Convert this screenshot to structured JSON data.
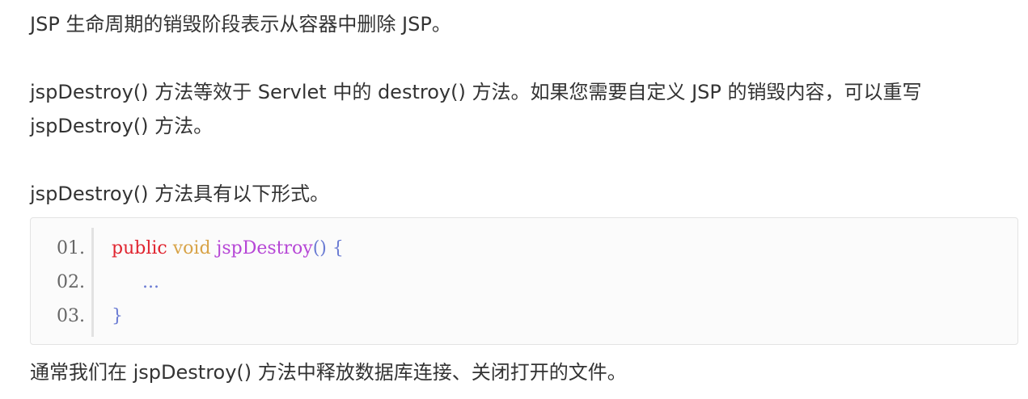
{
  "paragraphs": {
    "p1": "JSP 生命周期的销毁阶段表示从容器中删除 JSP。",
    "p2": "jspDestroy() 方法等效于 Servlet 中的 destroy() 方法。如果您需要自定义 JSP 的销毁内容，可以重写 jspDestroy() 方法。",
    "p3": "jspDestroy() 方法具有以下形式。",
    "p4": "通常我们在 jspDestroy() 方法中释放数据库连接、关闭打开的文件。"
  },
  "code": {
    "line_numbers": [
      "01.",
      "02.",
      "03."
    ],
    "line1": {
      "keyword": "public",
      "type": "void",
      "function": "jspDestroy",
      "parens": "()",
      "brace": "{"
    },
    "line2": "...",
    "line3": "}"
  },
  "colors": {
    "text": "#333333",
    "keyword": "#e0242f",
    "type": "#d8a347",
    "function": "#b646d6",
    "punctuation": "#6a7bd3",
    "code_background": "#fbfbfb"
  }
}
